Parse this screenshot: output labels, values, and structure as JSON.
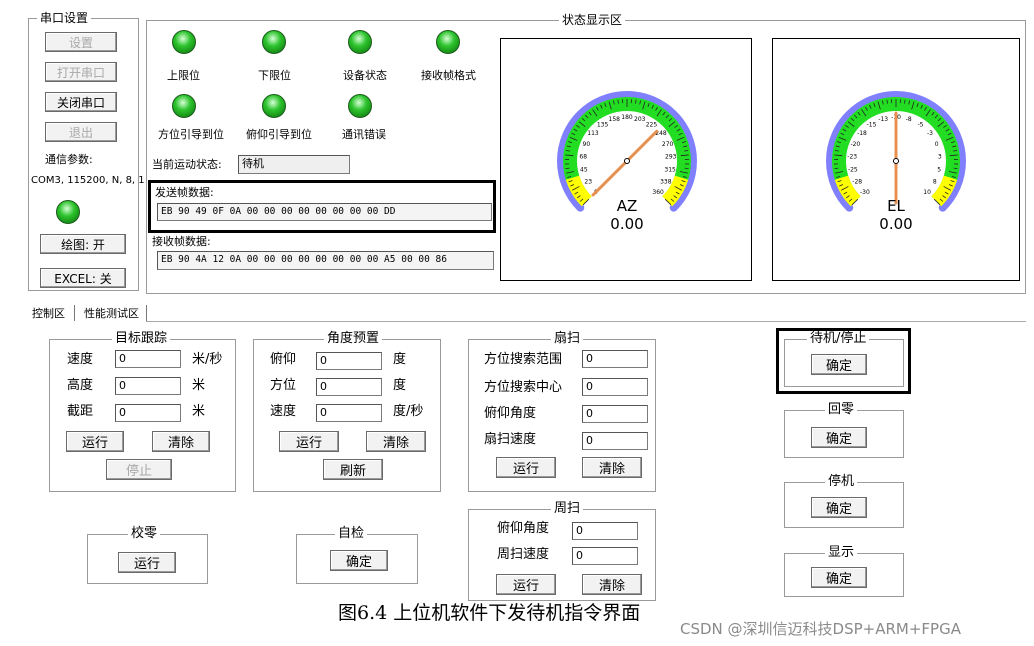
{
  "serial": {
    "title": "串口设置",
    "set_label": "设置",
    "open_label": "打开串口",
    "close_label": "关闭串口",
    "exit_label": "退出",
    "params_label": "通信参数:",
    "params_value": "COM3, 115200, N, 8, 1",
    "plot_label": "绘图: 开",
    "excel_label": "EXCEL: 关"
  },
  "status": {
    "title": "状态显示区",
    "leds": [
      "上限位",
      "下限位",
      "设备状态",
      "接收帧格式",
      "方位引导到位",
      "俯仰引导到位",
      "通讯错误"
    ],
    "led_color": "#2ec42e",
    "motion_label": "当前运动状态:",
    "motion_value": "待机",
    "send_label": "发送帧数据:",
    "send_value": "EB 90 49 0F 0A 00 00 00 00 00 00 00 00 DD",
    "recv_label": "接收帧数据:",
    "recv_value": "EB 90 4A 12 0A 00 00 00 00 00 00 00 00 A5 00 00 86",
    "highlight_color": "#000000"
  },
  "gauges": {
    "az": {
      "name": "AZ",
      "value": "0.00",
      "ticks": [
        "0",
        "23",
        "45",
        "68",
        "90",
        "113",
        "135",
        "158",
        "180",
        "203",
        "225",
        "248",
        "270",
        "293",
        "315",
        "338",
        "360"
      ]
    },
    "el": {
      "name": "EL",
      "value": "0.00",
      "ticks": [
        "-30",
        "-28",
        "-25",
        "-23",
        "-20",
        "-18",
        "-15",
        "-13",
        "-10",
        "-8",
        "-5",
        "-3",
        "0",
        "3",
        "5",
        "8",
        "10"
      ]
    },
    "colors": {
      "blue": "#8080ff",
      "green": "#22dd22",
      "yellow": "#ffff00",
      "needle": "#e89050"
    }
  },
  "tabs": [
    "控制区",
    "性能测试区"
  ],
  "tracking": {
    "title": "目标跟踪",
    "speed_label": "速度",
    "speed_value": "0",
    "speed_unit": "米/秒",
    "height_label": "高度",
    "height_value": "0",
    "height_unit": "米",
    "cut_label": "截距",
    "cut_value": "0",
    "cut_unit": "米",
    "run_label": "运行",
    "clear_label": "清除",
    "stop_label": "停止"
  },
  "preset": {
    "title": "角度预置",
    "pitch_label": "俯仰",
    "pitch_value": "0",
    "pitch_unit": "度",
    "az_label": "方位",
    "az_value": "0",
    "az_unit": "度",
    "speed_label": "速度",
    "speed_value": "0",
    "speed_unit": "度/秒",
    "run_label": "运行",
    "clear_label": "清除",
    "refresh_label": "刷新"
  },
  "sector": {
    "title": "扇扫",
    "range_label": "方位搜索范围",
    "range_value": "0",
    "center_label": "方位搜索中心",
    "center_value": "0",
    "pitch_label": "俯仰角度",
    "pitch_value": "0",
    "speed_label": "扇扫速度",
    "speed_value": "0",
    "run_label": "运行",
    "clear_label": "清除"
  },
  "circle": {
    "title": "周扫",
    "pitch_label": "俯仰角度",
    "pitch_value": "0",
    "speed_label": "周扫速度",
    "speed_value": "0",
    "run_label": "运行",
    "clear_label": "清除"
  },
  "zero": {
    "title": "校零",
    "run_label": "运行"
  },
  "selfcheck": {
    "title": "自检",
    "ok_label": "确定"
  },
  "standby": {
    "title": "待机/停止",
    "ok_label": "确定"
  },
  "home": {
    "title": "回零",
    "ok_label": "确定"
  },
  "halt": {
    "title": "停机",
    "ok_label": "确定"
  },
  "display": {
    "title": "显示",
    "ok_label": "确定"
  },
  "caption": "图6.4  上位机软件下发待机指令界面",
  "watermark": "CSDN @深圳信迈科技DSP+ARM+FPGA"
}
